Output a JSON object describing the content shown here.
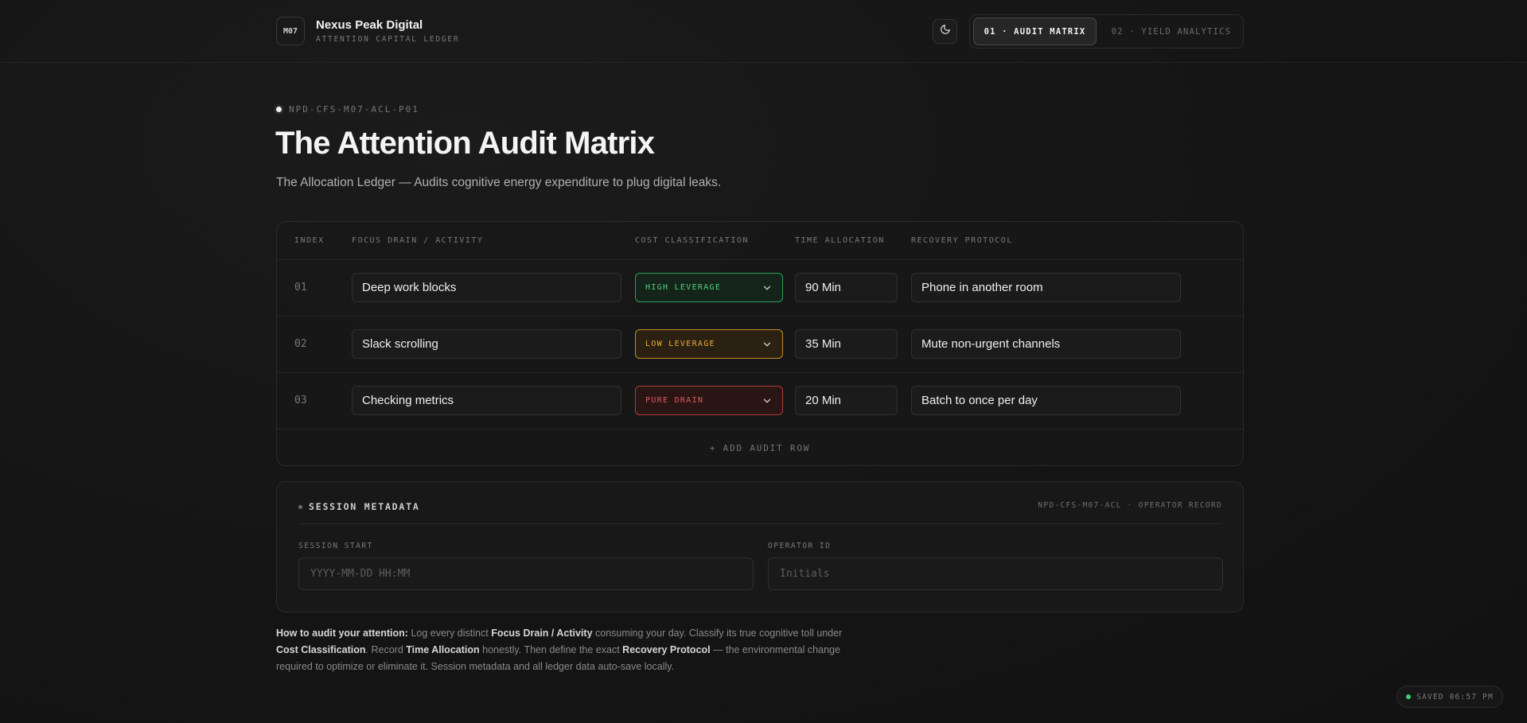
{
  "header": {
    "logo_text": "M07",
    "brand_name": "Nexus Peak Digital",
    "brand_subtitle": "ATTENTION CAPITAL LEDGER",
    "theme_toggle_icon": "moon-icon",
    "tabs": [
      {
        "label": "01 · AUDIT MATRIX",
        "active": true
      },
      {
        "label": "02 · YIELD ANALYTICS",
        "active": false
      }
    ]
  },
  "hero": {
    "doc_id": "NPD-CFS-M07-ACL-P01",
    "title": "The Attention Audit Matrix",
    "subtitle": "The Allocation Ledger — Audits cognitive energy expenditure to plug digital leaks."
  },
  "table": {
    "headers": {
      "index": "INDEX",
      "activity": "FOCUS DRAIN / ACTIVITY",
      "cost": "COST CLASSIFICATION",
      "time": "TIME ALLOCATION",
      "recovery": "RECOVERY PROTOCOL"
    },
    "rows": [
      {
        "index": "01",
        "activity": "Deep work blocks",
        "cost": "HIGH LEVERAGE",
        "time": "90 Min",
        "recovery": "Phone in another room"
      },
      {
        "index": "02",
        "activity": "Slack scrolling",
        "cost": "LOW LEVERAGE",
        "time": "35 Min",
        "recovery": "Mute non-urgent channels"
      },
      {
        "index": "03",
        "activity": "Checking metrics",
        "cost": "PURE DRAIN",
        "time": "20 Min",
        "recovery": "Batch to once per day"
      }
    ],
    "add_row_label": "+ ADD AUDIT ROW",
    "colors": {
      "high": "#4ed27e",
      "low": "#f0a93a",
      "drain": "#e0595a"
    }
  },
  "session": {
    "title": "SESSION METADATA",
    "record_label": "NPD-CFS-M07-ACL · OPERATOR RECORD",
    "start_label": "SESSION START",
    "start_placeholder": "YYYY-MM-DD HH:MM",
    "operator_label": "OPERATOR ID",
    "operator_placeholder": "Initials"
  },
  "instructions": {
    "lead": "How to audit your attention:",
    "t1": " Log every distinct ",
    "b1": "Focus Drain / Activity",
    "t2": " consuming your day. Classify its true cognitive toll under ",
    "b2": "Cost Classification",
    "t3": ". Record ",
    "b3": "Time Allocation",
    "t4": " honestly. Then define the exact ",
    "b4": "Recovery Protocol",
    "t5": " — the environmental change required to optimize or eliminate it. Session metadata and all ledger data auto-save locally."
  },
  "status": {
    "saved_text": "SAVED 06:57 PM"
  }
}
